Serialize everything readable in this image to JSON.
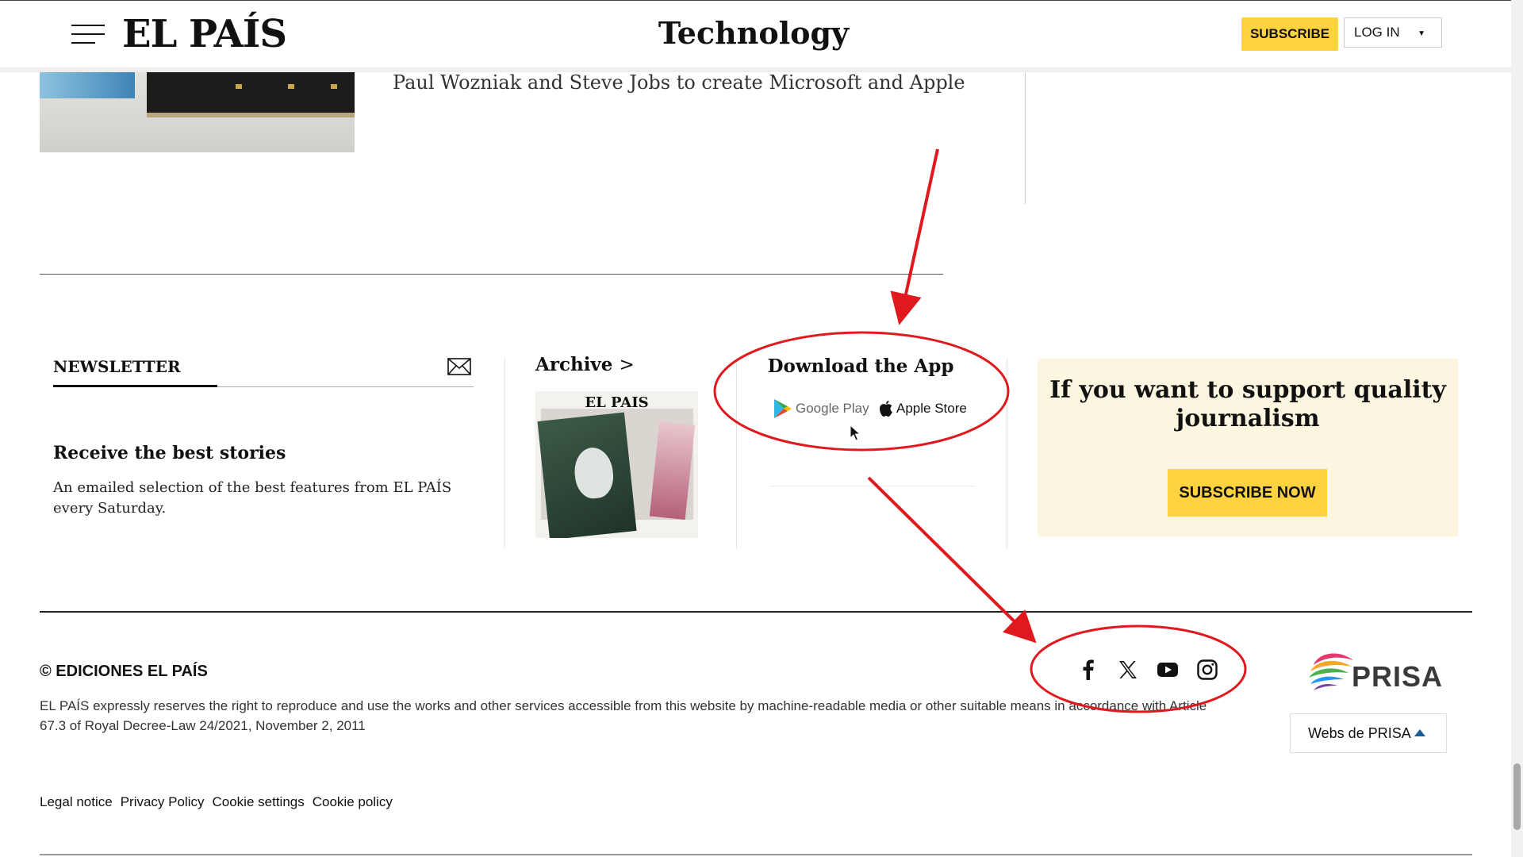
{
  "header": {
    "logo": "EL PAÍS",
    "section": "Technology",
    "subscribe": "SUBSCRIBE",
    "login": "LOG IN"
  },
  "article": {
    "snippet": "Paul Wozniak and Steve Jobs to create Microsoft and Apple"
  },
  "newsletter": {
    "tab": "NEWSLETTER",
    "heading": "Receive the best stories",
    "description": "An emailed selection of the best features from EL PAÍS every Saturday."
  },
  "archive": {
    "title": "Archive",
    "arrow": ">",
    "masthead": "EL PAIS"
  },
  "app": {
    "title": "Download the App",
    "google_play": "Google Play",
    "apple_store": "Apple Store"
  },
  "support": {
    "title": "If you want to support quality journalism",
    "button": "SUBSCRIBE NOW"
  },
  "footer": {
    "copyright": "© EDICIONES EL PAÍS",
    "legal": "EL PAÍS expressly reserves the right to reproduce and use the works and other services accessible from this website by machine-readable media or other suitable means in accordance with Article 67.3 of Royal Decree-Law 24/2021, November 2, 2011",
    "social": [
      "facebook-icon",
      "x-icon",
      "youtube-icon",
      "instagram-icon"
    ],
    "prisa": "PRISA",
    "webs_prisa": "Webs de PRISA",
    "links": [
      "Legal notice",
      "Privacy Policy",
      "Cookie settings",
      "Cookie policy"
    ]
  },
  "colors": {
    "accent_yellow": "#ffd23f",
    "support_bg": "#fcf6e0",
    "annotation_red": "#e0191e"
  }
}
